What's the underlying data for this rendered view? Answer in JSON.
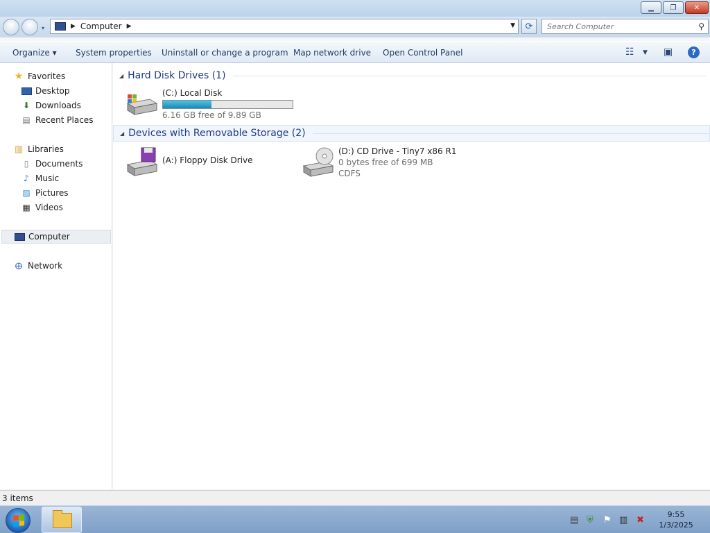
{
  "window": {
    "minimize_glyph": "▁",
    "maximize_glyph": "❐",
    "close_glyph": "✕"
  },
  "address_bar": {
    "path": "Computer",
    "search_placeholder": "Search Computer"
  },
  "command_bar": {
    "organize": "Organize ▾",
    "system_properties": "System properties",
    "uninstall": "Uninstall or change a program",
    "map_drive": "Map network drive",
    "control_panel": "Open Control Panel",
    "help_glyph": "?"
  },
  "nav_pane": {
    "favorites": "Favorites",
    "desktop": "Desktop",
    "downloads": "Downloads",
    "recent_places": "Recent Places",
    "libraries": "Libraries",
    "documents": "Documents",
    "music": "Music",
    "pictures": "Pictures",
    "videos": "Videos",
    "computer": "Computer",
    "network": "Network"
  },
  "groups": {
    "hdd": "Hard Disk Drives (1)",
    "removable": "Devices with Removable Storage (2)"
  },
  "drives": {
    "c": {
      "name": "(C:) Local Disk",
      "free": "6.16 GB free of 9.89 GB",
      "used_fraction": 0.377
    },
    "a": {
      "name": "(A:) Floppy Disk Drive"
    },
    "d": {
      "name": "(D:) CD Drive - Tiny7 x86 R1",
      "free": "0 bytes free of 699 MB",
      "fs": "CDFS"
    }
  },
  "status_bar": {
    "items": "3 items"
  },
  "taskbar": {
    "time": "9:55",
    "date": "1/3/2025"
  },
  "colors": {
    "accent": "#1e3a8a",
    "bar_fill": "#1b89b8"
  }
}
